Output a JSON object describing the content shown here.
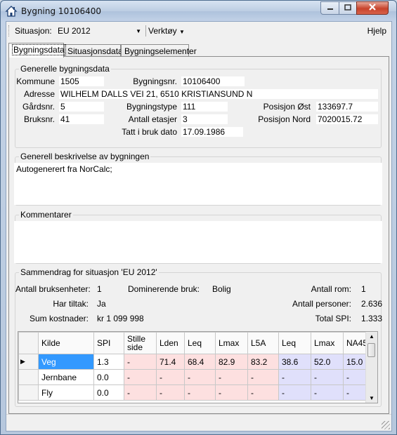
{
  "window": {
    "title": "Bygning 10106400"
  },
  "toolbar": {
    "situation_label": "Situasjon:",
    "situation_value": "EU 2012",
    "tools_menu": "Verktøy",
    "help_menu": "Hjelp"
  },
  "tabs": [
    {
      "label": "Bygningsdata"
    },
    {
      "label": "Situasjonsdata"
    },
    {
      "label": "Bygningselementer"
    }
  ],
  "general": {
    "title": "Generelle bygningsdata",
    "kommune_label": "Kommune",
    "kommune_value": "1505",
    "bygningsnr_label": "Bygningsnr.",
    "bygningsnr_value": "10106400",
    "adresse_label": "Adresse",
    "adresse_value": "WILHELM DALLS VEI 21, 6510 KRISTIANSUND N",
    "gardsnr_label": "Gårdsnr.",
    "gardsnr_value": "5",
    "bygningstype_label": "Bygningstype",
    "bygningstype_value": "111",
    "posisjon_ost_label": "Posisjon Øst",
    "posisjon_ost_value": "133697.7",
    "bruksnr_label": "Bruksnr.",
    "bruksnr_value": "41",
    "antall_etasjer_label": "Antall etasjer",
    "antall_etasjer_value": "3",
    "posisjon_nord_label": "Posisjon Nord",
    "posisjon_nord_value": "7020015.72",
    "tatt_i_bruk_label": "Tatt i bruk dato",
    "tatt_i_bruk_value": "17.09.1986"
  },
  "description": {
    "title": "Generell beskrivelse av bygningen",
    "text": "Autogenerert fra NorCalc;"
  },
  "comments": {
    "title": "Kommentarer",
    "text": ""
  },
  "summary": {
    "title": "Sammendrag for situasjon 'EU 2012'",
    "bruksenheter_label": "Antall bruksenheter:",
    "bruksenheter_value": "1",
    "dominerende_label": "Dominerende bruk:",
    "dominerende_value": "Bolig",
    "rom_label": "Antall rom:",
    "rom_value": "1",
    "tiltak_label": "Har tiltak:",
    "tiltak_value": "Ja",
    "personer_label": "Antall personer:",
    "personer_value": "2.636",
    "kostnader_label": "Sum kostnader:",
    "kostnader_value": "kr 1 099 998",
    "spi_label": "Total SPI:",
    "spi_value": "1.333"
  },
  "grid": {
    "columns": [
      "Kilde",
      "SPI",
      "Stille side",
      "Lden",
      "Leq",
      "Lmax",
      "L5A",
      "Leq",
      "Lmax",
      "NA45"
    ],
    "rows": [
      [
        "Veg",
        "1.3",
        "-",
        "71.4",
        "68.4",
        "82.9",
        "83.2",
        "38.6",
        "52.0",
        "15.0"
      ],
      [
        "Jernbane",
        "0.0",
        "-",
        "-",
        "-",
        "-",
        "-",
        "-",
        "-",
        "-"
      ],
      [
        "Fly",
        "0.0",
        "-",
        "-",
        "-",
        "-",
        "-",
        "-",
        "-",
        "-"
      ]
    ],
    "current_row_marker": "▶"
  },
  "colors": {
    "selected": "#3399ff",
    "pink_cells": "#fde0e0",
    "blue_cells": "#e0e0fb",
    "close_button": "#c7432b"
  }
}
